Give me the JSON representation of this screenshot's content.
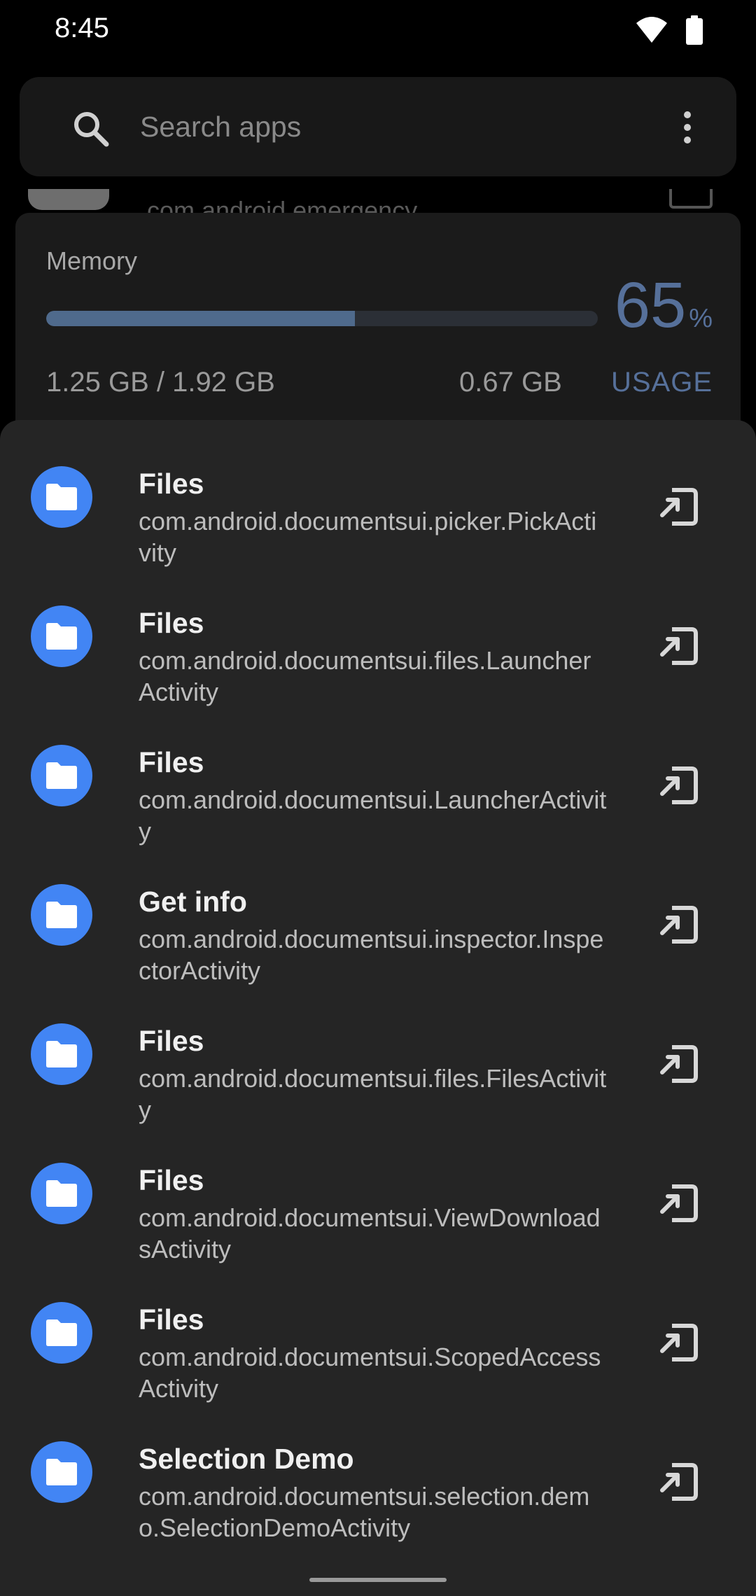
{
  "status_bar": {
    "time": "8:45",
    "icons": [
      "wifi-icon",
      "battery-icon"
    ]
  },
  "search": {
    "placeholder": "Search apps",
    "menu_icon": "more-vert-icon"
  },
  "peek_row": {
    "text": "com.android.emergency"
  },
  "memory": {
    "label": "Memory",
    "percent": "65",
    "percent_symbol": "%",
    "used_total": "1.25 GB / 1.92 GB",
    "free": "0.67 GB",
    "usage_label": "USAGE",
    "bar_fill_fraction": 0.56,
    "colors": {
      "accent": "#56709a",
      "bar": "#4f6a8c",
      "track": "#2b2f36"
    }
  },
  "activities": [
    {
      "title": "Files",
      "package": "com.android.documentsui.picker.PickActivity"
    },
    {
      "title": "Files",
      "package": "com.android.documentsui.files.LauncherActivity"
    },
    {
      "title": "Files",
      "package": "com.android.documentsui.LauncherActivity"
    },
    {
      "title": "Get info",
      "package": "com.android.documentsui.inspector.InspectorActivity"
    },
    {
      "title": "Files",
      "package": "com.android.documentsui.files.FilesActivity"
    },
    {
      "title": "Files",
      "package": "com.android.documentsui.ViewDownloadsActivity"
    },
    {
      "title": "Files",
      "package": "com.android.documentsui.ScopedAccessActivity"
    },
    {
      "title": "Selection Demo",
      "package": "com.android.documentsui.selection.demo.SelectionDemoActivity"
    }
  ],
  "icons": {
    "app": "folder-icon",
    "action": "launch-activity-icon"
  },
  "colors": {
    "app_icon_bg": "#4285f4",
    "sheet_bg": "#252525"
  }
}
